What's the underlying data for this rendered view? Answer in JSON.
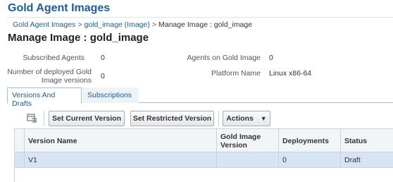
{
  "app": {
    "title": "Gold Agent Images"
  },
  "breadcrumb": {
    "items": [
      "Gold Agent Images",
      "gold_image (Image)"
    ],
    "current": "Manage Image : gold_image",
    "separator": ">"
  },
  "page": {
    "title": "Manage Image : gold_image"
  },
  "properties": {
    "subscribed_agents": {
      "label": "Subscribed Agents",
      "value": "0"
    },
    "agents_on_gold_image": {
      "label": "Agents on Gold Image",
      "value": "0"
    },
    "deployed_versions": {
      "label_line1": "Number of deployed Gold",
      "label_line2": "Image versions",
      "value": "0"
    },
    "platform_name": {
      "label": "Platform Name",
      "value": "Linux x86-64"
    }
  },
  "tabs": [
    {
      "label": "Versions And Drafts",
      "active": true
    },
    {
      "label": "Subscriptions",
      "active": false
    }
  ],
  "toolbar": {
    "detach_icon": "detach-icon",
    "set_current_version": "Set Current Version",
    "set_restricted_version": "Set Restricted Version",
    "actions": "Actions",
    "actions_caret": "▼"
  },
  "table": {
    "columns": [
      "Version Name",
      "Gold Image Version",
      "Deployments",
      "Status"
    ],
    "rows": [
      {
        "version_name": "V1",
        "gold_image_version": "",
        "deployments": "0",
        "status": "Draft"
      }
    ]
  },
  "colors": {
    "title_blue": "#1f5c99",
    "selected_row": "#d6e4f3",
    "header_bg": "#f2f5f8"
  }
}
